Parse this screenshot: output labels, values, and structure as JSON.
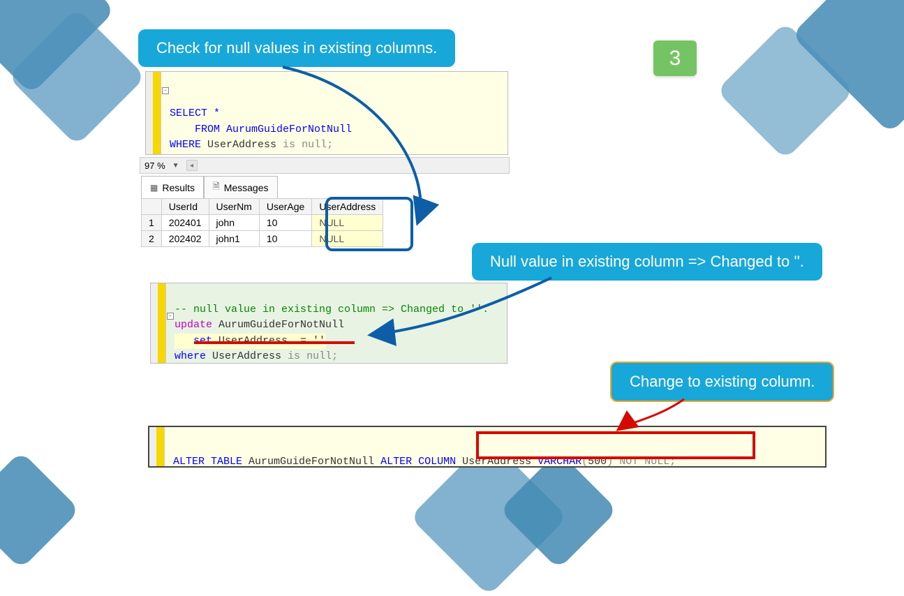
{
  "step_number": "3",
  "callouts": {
    "check_null": "Check for null values in existing columns.",
    "changed_to": "Null value in existing column => Changed to ''.",
    "change_existing": "Change to existing column."
  },
  "editor1": {
    "zoom": "97 %",
    "select_line": "SELECT *",
    "from_line": "FROM AurumGuideForNotNull",
    "where_line": "WHERE UserAddress is null;"
  },
  "tabs": {
    "results": "Results",
    "messages": "Messages"
  },
  "grid": {
    "headers": [
      "UserId",
      "UserNm",
      "UserAge",
      "UserAddress"
    ],
    "rows": [
      {
        "n": "1",
        "UserId": "202401",
        "UserNm": "john",
        "UserAge": "10",
        "UserAddress": "NULL"
      },
      {
        "n": "2",
        "UserId": "202402",
        "UserNm": "john1",
        "UserAge": "10",
        "UserAddress": "NULL"
      }
    ]
  },
  "editor2": {
    "comment": "-- null value in existing column => Changed to ''.",
    "update_kw": "update",
    "update_tbl": " AurumGuideForNotNull",
    "set_line_kw": "set",
    "set_line_rest": " UserAddress  = ''",
    "where_kw": "where",
    "where_rest": " UserAddress ",
    "where_is": "is",
    "where_null": " null",
    "semicolon": ";"
  },
  "editor3": {
    "alter_kw": "ALTER",
    "table_kw": " TABLE",
    "tbl": " AurumGuideForNotNull ",
    "alter2_kw": "ALTER",
    "column_kw": " COLUMN",
    "col": " UserAddress ",
    "type_kw": "VARCHAR",
    "paren_open": "(",
    "size": "500",
    "paren_close": ")",
    "notnull": " NOT NULL",
    "semicolon": ";"
  }
}
